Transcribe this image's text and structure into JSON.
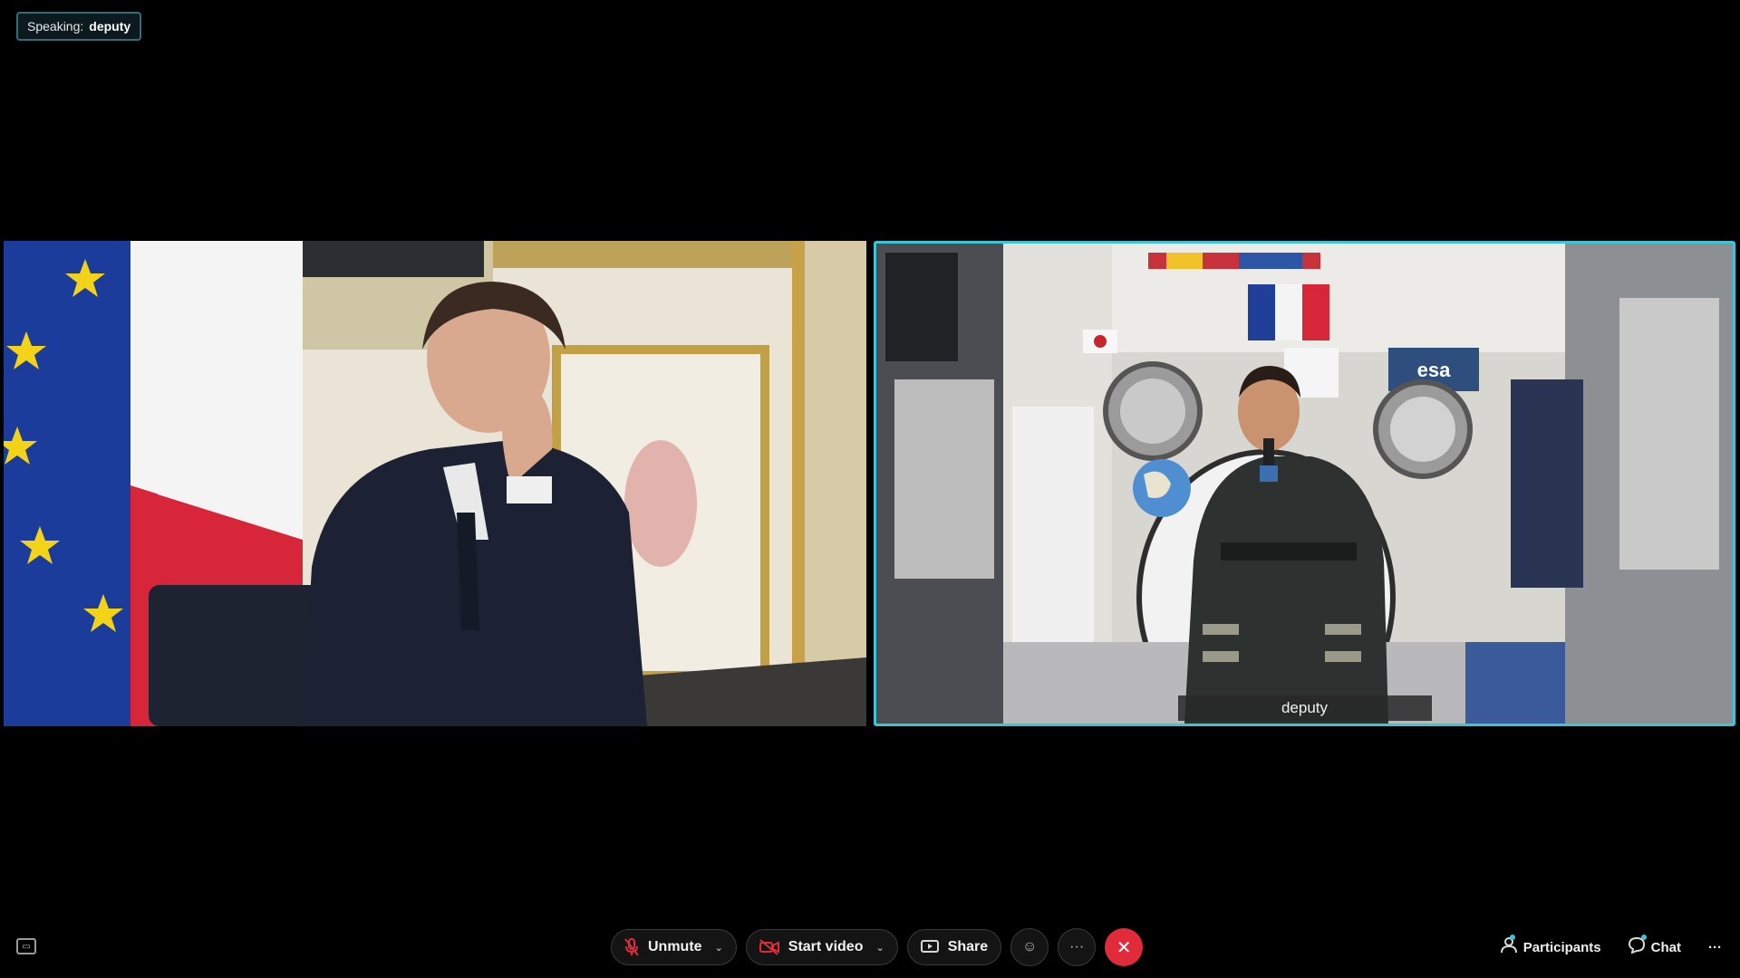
{
  "speaking": {
    "label": "Speaking:",
    "name": "deputy"
  },
  "tiles": [
    {
      "id": "left",
      "active": false,
      "name_tag": ""
    },
    {
      "id": "right",
      "active": true,
      "name_tag": "deputy"
    }
  ],
  "controls": {
    "unmute_label": "Unmute",
    "start_video_label": "Start video",
    "share_label": "Share",
    "more_label": "···",
    "participants_label": "Participants",
    "chat_label": "Chat",
    "overflow_label": "···"
  },
  "colors": {
    "active_speaker_border": "#3ec4d6",
    "end_call": "#e22b3a",
    "muted_icon": "#e22b3a",
    "background": "#000000"
  },
  "icons": {
    "unmute": "microphone-muted-icon",
    "video": "camera-off-icon",
    "share": "share-screen-icon",
    "reactions": "emoji-icon",
    "end": "close-icon",
    "participants": "person-icon",
    "chat": "chat-bubble-icon"
  }
}
